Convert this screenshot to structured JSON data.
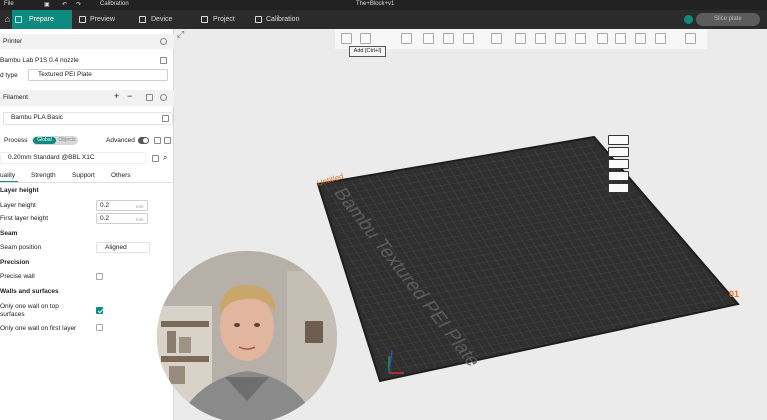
{
  "titlebar": {
    "file_menu": "File",
    "calibration_small": "Calibration",
    "project_name": "The+Block+v1"
  },
  "nav": {
    "tabs": [
      {
        "label": "Prepare",
        "icon": "cube-icon",
        "active": true
      },
      {
        "label": "Preview",
        "icon": "eye-icon",
        "active": false
      },
      {
        "label": "Device",
        "icon": "monitor-icon",
        "active": false
      },
      {
        "label": "Project",
        "icon": "folder-icon",
        "active": false
      },
      {
        "label": "Calibration",
        "icon": "calibration-icon",
        "active": false
      }
    ],
    "slice_button": "Slice plate",
    "accent": "#0e8a7e"
  },
  "printer": {
    "header": "Printer",
    "name": "Bambu Lab P1S 0.4 nozzle",
    "bed_type_label": "d type",
    "bed_type_value": "Textured PEI Plate"
  },
  "filament": {
    "header": "Filament",
    "selected": "Bambu PLA Basic"
  },
  "process": {
    "header": "Process",
    "toggle_global": "Global",
    "toggle_objects": "Objects",
    "advanced_label": "Advanced",
    "preset": "0.20mm Standard @BBL X1C",
    "tabs": [
      "uality",
      "Strength",
      "Support",
      "Others"
    ]
  },
  "settings": {
    "layer_height_group": "Layer height",
    "layer_height_label": "Layer height",
    "layer_height_value": "0.2",
    "first_layer_height_label": "First layer height",
    "first_layer_height_value": "0.2",
    "unit": "mm",
    "seam_group": "Seam",
    "seam_position_label": "Seam position",
    "seam_position_value": "Aligned",
    "precision_group": "Precision",
    "precise_wall_label": "Precise wall",
    "walls_group": "Walls and surfaces",
    "only_one_wall_top_label": "Only one wall on top",
    "only_one_wall_top_label2": "surfaces",
    "only_one_wall_first_label": "Only one wall on first layer"
  },
  "viewport": {
    "tooltip": "Add [Ctrl+I]",
    "plate_name": "Untitled",
    "plate_label": "Bambu Textured PEI Plate",
    "plate_number": "01"
  }
}
